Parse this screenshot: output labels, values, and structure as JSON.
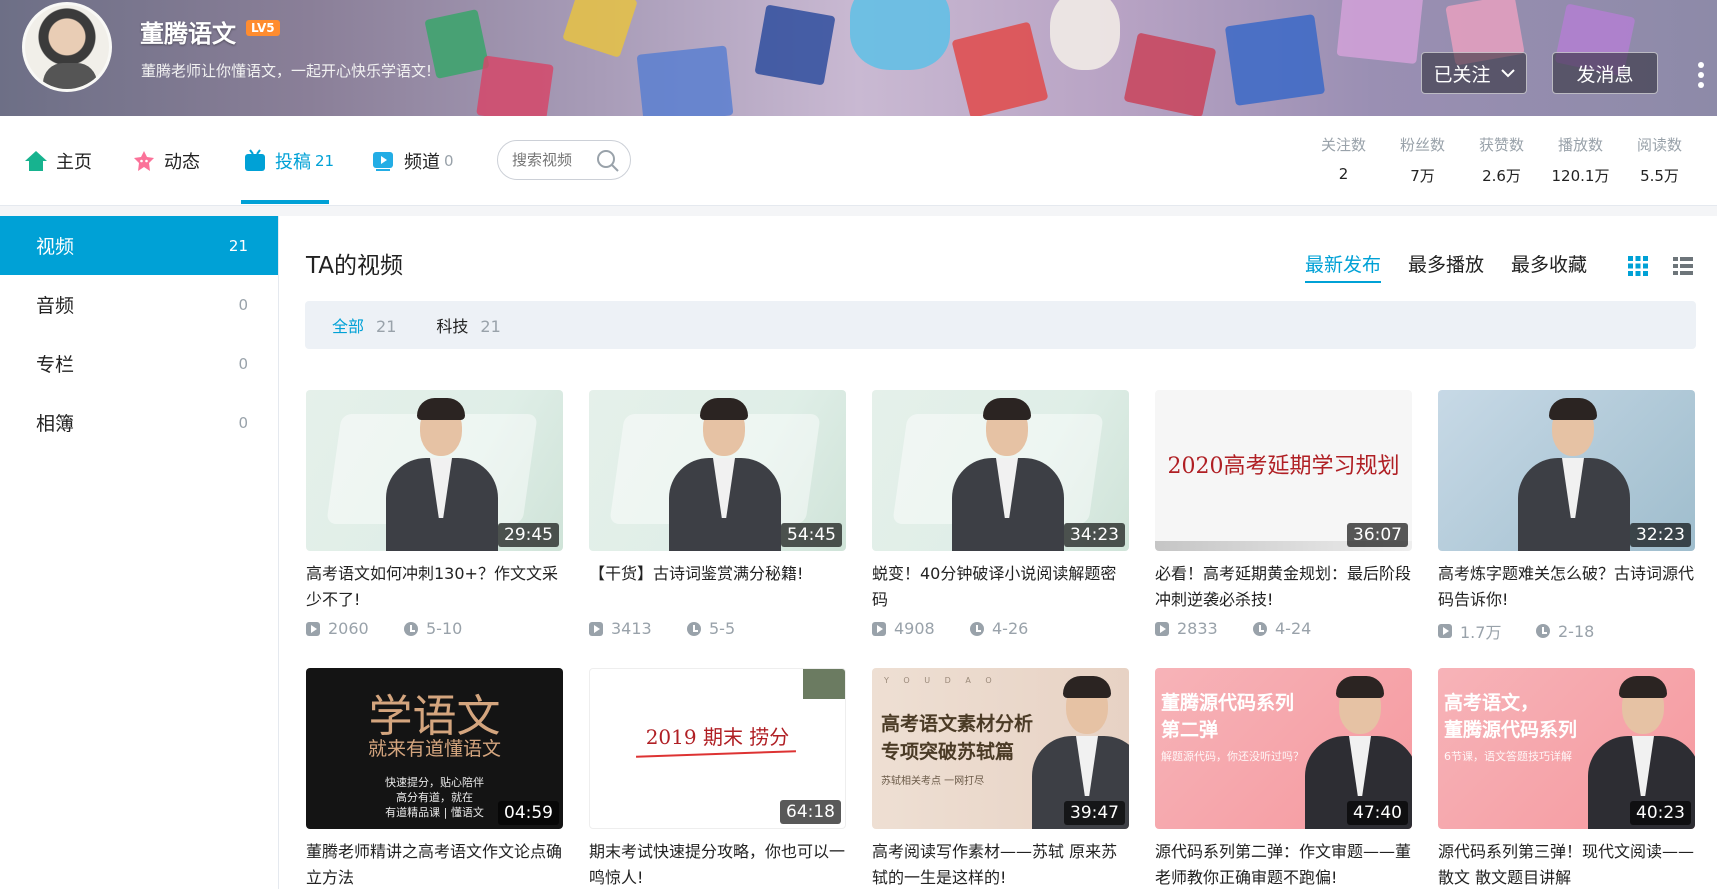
{
  "user": {
    "name": "董腾语文",
    "level": "LV5",
    "sign": "董腾老师让你懂语文，一起开心快乐学语文!"
  },
  "actions": {
    "follow_label": "已关注",
    "message_label": "发消息"
  },
  "nav": {
    "home": "主页",
    "dynamic": "动态",
    "videos": "投稿",
    "videos_count": "21",
    "channels": "频道",
    "channels_count": "0",
    "search_placeholder": "搜索视频"
  },
  "stats": [
    {
      "label": "关注数",
      "value": "2"
    },
    {
      "label": "粉丝数",
      "value": "7万"
    },
    {
      "label": "获赞数",
      "value": "2.6万"
    },
    {
      "label": "播放数",
      "value": "120.1万"
    },
    {
      "label": "阅读数",
      "value": "5.5万"
    }
  ],
  "sidebar": {
    "items": [
      {
        "label": "视频",
        "count": "21"
      },
      {
        "label": "音频",
        "count": "0"
      },
      {
        "label": "专栏",
        "count": "0"
      },
      {
        "label": "相簿",
        "count": "0"
      }
    ]
  },
  "main": {
    "title": "TA的视频",
    "sorts": [
      "最新发布",
      "最多播放",
      "最多收藏"
    ],
    "filters": [
      {
        "label": "全部",
        "count": "21"
      },
      {
        "label": "科技",
        "count": "21"
      }
    ]
  },
  "videos": [
    {
      "title": "高考语文如何冲刺130+？作文文采少不了!",
      "duration": "29:45",
      "plays": "2060",
      "date": "5-10"
    },
    {
      "title": "【干货】古诗词鉴赏满分秘籍!",
      "duration": "54:45",
      "plays": "3413",
      "date": "5-5"
    },
    {
      "title": "蜕变！40分钟破译小说阅读解题密码",
      "duration": "34:23",
      "plays": "4908",
      "date": "4-26"
    },
    {
      "title": "必看！高考延期黄金规划：最后阶段冲刺逆袭必杀技!",
      "duration": "36:07",
      "plays": "2833",
      "date": "4-24"
    },
    {
      "title": "高考炼字题难关怎么破？古诗词源代码告诉你!",
      "duration": "32:23",
      "plays": "1.7万",
      "date": "2-18"
    },
    {
      "title": "董腾老师精讲之高考语文作文论点确立方法",
      "duration": "04:59"
    },
    {
      "title": "期末考试快速提分攻略，你也可以一鸣惊人!",
      "duration": "64:18"
    },
    {
      "title": "高考阅读写作素材——苏轼 原来苏轼的一生是这样的!",
      "duration": "39:47"
    },
    {
      "title": "源代码系列第二弹：作文审题——董老师教你正确审题不跑偏!",
      "duration": "47:40"
    },
    {
      "title": "源代码系列第三弹！现代文阅读——散文 散文题目讲解",
      "duration": "40:23"
    }
  ],
  "thumb_text": {
    "plan": "2020高考延期学习规划",
    "dark_big": "学语文",
    "dark_sub": "就来有道懂语文",
    "dark_lines": [
      "快速提分，贴心陪伴",
      "高分有道，就在",
      "有道精品课 | 懂语文"
    ],
    "exam": "2019 期末 捞分",
    "beige_top": "Y O U D A O",
    "beige_title_1": "高考语文素材分析",
    "beige_title_2": "专项突破苏轼篇",
    "beige_sub": "苏轼相关考点 一网打尽",
    "pink1_title_1": "董腾源代码系列",
    "pink1_title_2": "第二弹",
    "pink1_sub": "解题源代码，你还没听过吗？",
    "pink2_title_1": "高考语文，",
    "pink2_title_2": "董腾源代码系列",
    "pink2_sub": "6节课，语文答题技巧详解"
  },
  "colors": {
    "accent": "#00a1d6",
    "level_badge": "#ff8c2f"
  }
}
